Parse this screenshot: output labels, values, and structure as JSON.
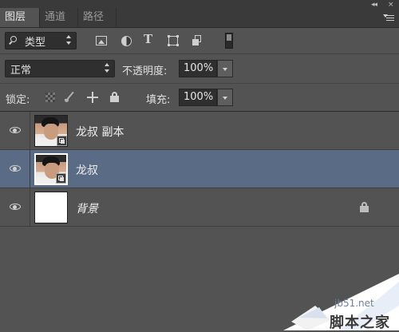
{
  "tabs": [
    {
      "label": "图层",
      "active": true
    },
    {
      "label": "通道",
      "active": false
    },
    {
      "label": "路径",
      "active": false
    }
  ],
  "window_controls": {
    "collapse": "◂◂",
    "close": "×"
  },
  "filter": {
    "kind_label": "类型",
    "icons": [
      "pixel-filter-icon",
      "adjustment-filter-icon",
      "type-filter-icon",
      "shape-filter-icon",
      "smart-object-filter-icon"
    ]
  },
  "blend": {
    "mode": "正常",
    "opacity_label": "不透明度:",
    "opacity_value": "100%"
  },
  "lock": {
    "label": "锁定:",
    "fill_label": "填充:",
    "fill_value": "100%"
  },
  "layers": [
    {
      "name": "龙叔 副本",
      "selected": false,
      "visible": true,
      "thumb": "photo"
    },
    {
      "name": "龙叔",
      "selected": true,
      "visible": true,
      "thumb": "photo"
    },
    {
      "name": "背景",
      "selected": false,
      "visible": true,
      "thumb": "white",
      "locked": true
    }
  ],
  "watermark": {
    "site": "jb51.net",
    "text": "脚本之家"
  },
  "colors": {
    "panel_bg": "#535353",
    "tabbar_bg": "#3a3a3a",
    "selected_row": "#5a6b85"
  }
}
